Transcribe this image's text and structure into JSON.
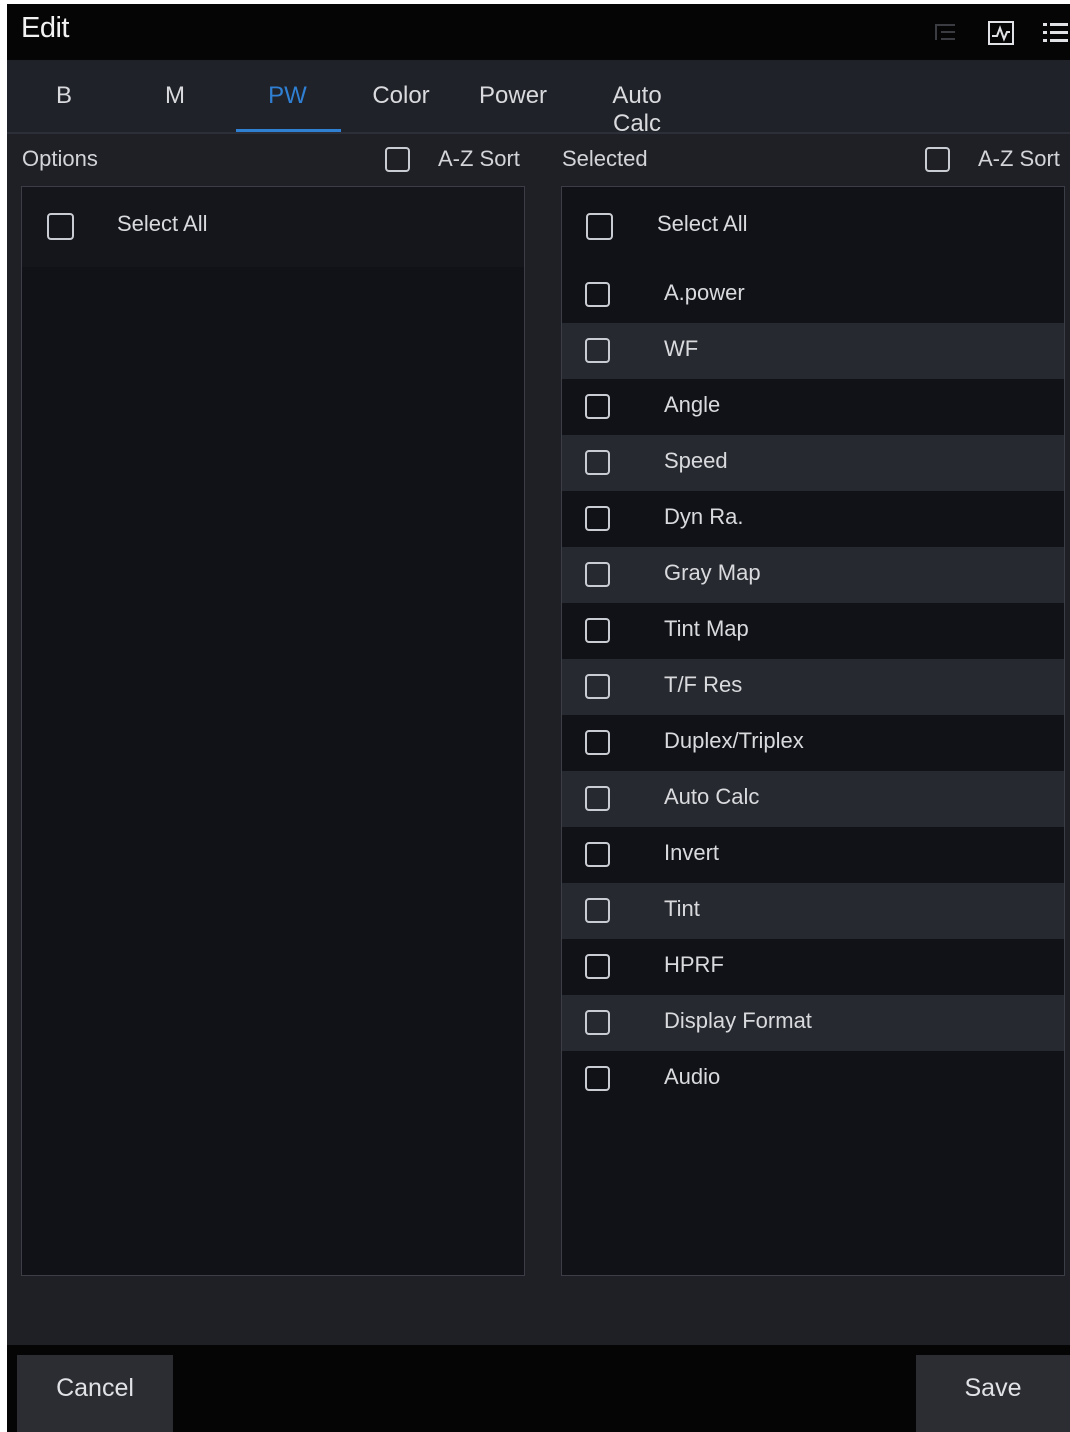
{
  "title": "Edit",
  "toolbar_icons": [
    "list-indent-icon",
    "waveform-icon",
    "menu-list-icon"
  ],
  "tabs": [
    {
      "label": "B",
      "active": false
    },
    {
      "label": "M",
      "active": false
    },
    {
      "label": "PW",
      "active": true
    },
    {
      "label": "Color",
      "active": false
    },
    {
      "label": "Power",
      "active": false
    },
    {
      "label": "Auto Calc",
      "active": false
    }
  ],
  "options_panel": {
    "header": "Options",
    "sort_label": "A-Z Sort",
    "select_all_label": "Select All",
    "items": []
  },
  "selected_panel": {
    "header": "Selected",
    "sort_label": "A-Z Sort",
    "select_all_label": "Select All",
    "items": [
      "A.power",
      "WF",
      "Angle",
      "Speed",
      "Dyn Ra.",
      "Gray Map",
      "Tint Map",
      "T/F Res",
      "Duplex/Triplex",
      "Auto Calc",
      "Invert",
      "Tint",
      "HPRF",
      "Display Format",
      "Audio"
    ]
  },
  "footer": {
    "cancel_label": "Cancel",
    "save_label": "Save"
  },
  "colors": {
    "accent": "#2f7fd3",
    "background": "#1e2026",
    "list_bg": "#111217"
  }
}
